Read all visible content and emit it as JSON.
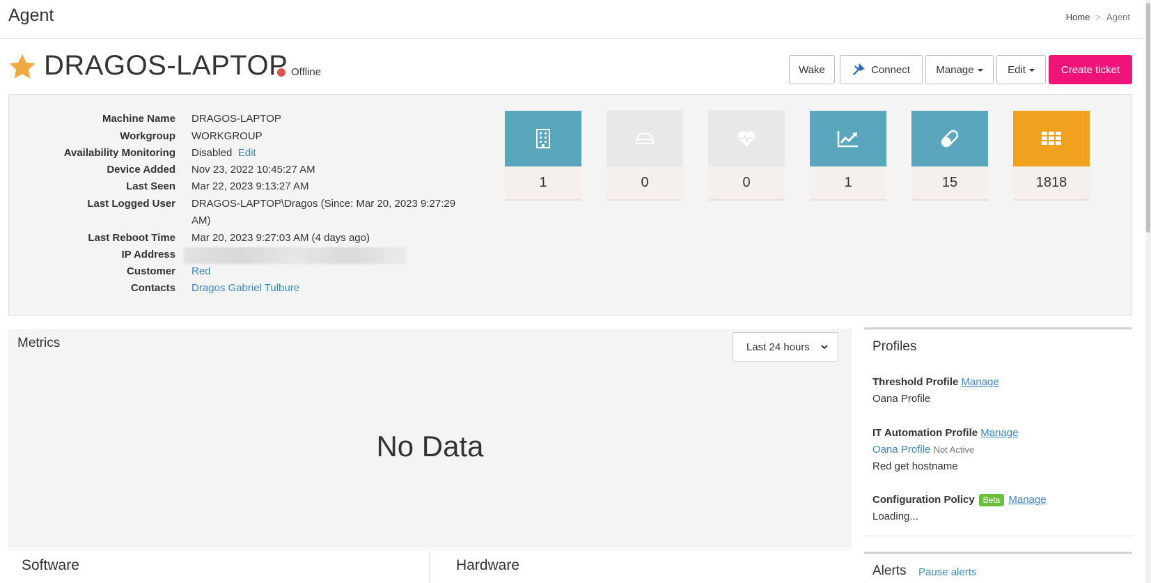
{
  "header": {
    "page_title": "Agent",
    "breadcrumb": {
      "home": "Home",
      "sep": ">",
      "current": "Agent"
    }
  },
  "device": {
    "name": "DRAGOS-LAPTOP",
    "status": "Offline",
    "status_color": "#d9534f",
    "favorite_icon": "star-icon"
  },
  "actions": {
    "wake": "Wake",
    "connect": "Connect",
    "manage": "Manage",
    "edit": "Edit",
    "create_ticket": "Create ticket"
  },
  "info": {
    "machine_name_label": "Machine Name",
    "machine_name": "DRAGOS-LAPTOP",
    "workgroup_label": "Workgroup",
    "workgroup": "WORKGROUP",
    "availability_label": "Availability Monitoring",
    "availability": "Disabled",
    "availability_edit": "Edit",
    "device_added_label": "Device Added",
    "device_added": "Nov 23, 2022 10:45:27 AM",
    "last_seen_label": "Last Seen",
    "last_seen": "Mar 22, 2023 9:13:27 AM",
    "last_user_label": "Last Logged User",
    "last_user_line1": "DRAGOS-LAPTOP\\Dragos (Since: Mar 20, 2023 9:27:29",
    "last_user_line2": "AM)",
    "last_reboot_label": "Last Reboot Time",
    "last_reboot": "Mar 20, 2023 9:27:03 AM (4 days ago)",
    "ip_label": "IP Address",
    "customer_label": "Customer",
    "customer": "Red",
    "contacts_label": "Contacts",
    "contacts": "Dragos Gabriel Tulbure"
  },
  "tiles": [
    {
      "icon": "building-icon",
      "value": "1",
      "color": "#5aa6bd"
    },
    {
      "icon": "hard-drive-icon",
      "value": "0",
      "color": "#e8e8e8"
    },
    {
      "icon": "heartbeat-icon",
      "value": "0",
      "color": "#e8e8e8"
    },
    {
      "icon": "line-chart-icon",
      "value": "1",
      "color": "#5aa6bd"
    },
    {
      "icon": "pill-icon",
      "value": "15",
      "color": "#5aa6bd"
    },
    {
      "icon": "grid-icon",
      "value": "1818",
      "color": "#f0a21e"
    }
  ],
  "metrics": {
    "title": "Metrics",
    "range": "Last 24 hours",
    "empty_text": "No Data"
  },
  "sections": {
    "software": "Software",
    "hardware": "Hardware"
  },
  "profiles": {
    "title": "Profiles",
    "threshold_label": "Threshold Profile",
    "threshold_manage": "Manage",
    "threshold_value": "Oana Profile",
    "automation_label": "IT Automation Profile",
    "automation_manage": "Manage",
    "automation_value": "Oana Profile",
    "automation_status": "Not Active",
    "automation_value2": "Red get hostname",
    "config_label": "Configuration Policy",
    "config_badge": "Beta",
    "config_manage": "Manage",
    "config_status": "Loading..."
  },
  "alerts": {
    "title": "Alerts",
    "pause": "Pause alerts"
  }
}
